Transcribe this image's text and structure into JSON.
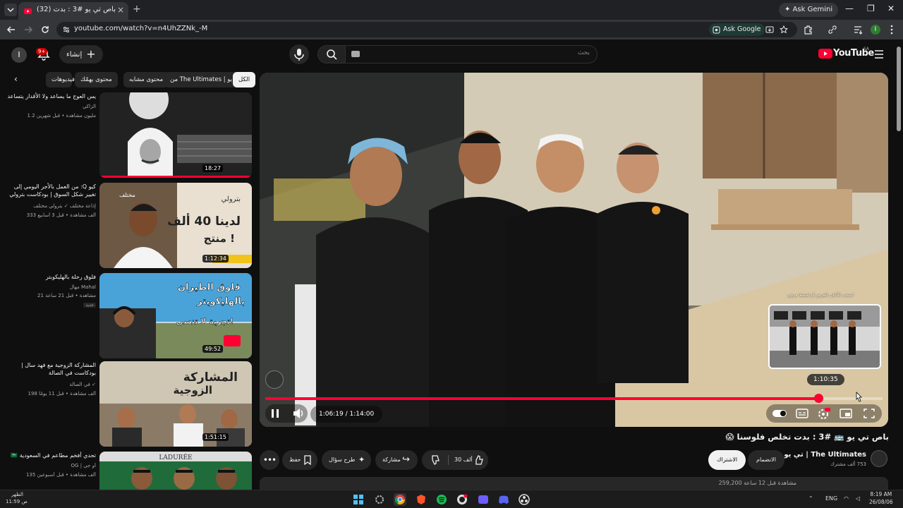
{
  "browser": {
    "tab_title": "باص تي يو #3 : بدت (32)",
    "url": "youtube.com/watch?v=n4UhZZNk_-M",
    "ask_gemini": "Ask Gemini",
    "ask_google": "Ask Google",
    "profile_initial": "I"
  },
  "masthead": {
    "avatar_initial": "I",
    "notif_count": "9+",
    "create_label": "إنشاء",
    "search_placeholder": "بحث",
    "logo_text": "YouTube",
    "region": "SA"
  },
  "chips": [
    {
      "label": "الكل",
      "active": true
    },
    {
      "label": "من The Ultimates | تي يو",
      "active": false
    },
    {
      "label": "محتوى مشابه",
      "active": false
    },
    {
      "label": "محتوى يهمّك",
      "active": false
    },
    {
      "label": "فيديوهات",
      "active": false
    }
  ],
  "recommendations": [
    {
      "title": "يس العوج ما يساعد ولا الأقدار يتساعد",
      "channel": "الزاكي",
      "meta": "1.2 مليون مشاهدة • قبل شهرين",
      "badge": "",
      "duration": "18:27",
      "progress": 1.0
    },
    {
      "title": "كيو Q: من العمل بالأجر اليومي إلى تغيير شكل السوق | بودكاست بترولي",
      "channel": "إذاعة مختلف ✓ بترولي مختلف",
      "meta": "333 ألف مشاهدة • قبل 3 أسابيع",
      "badge": "",
      "duration": "1:12:34",
      "progress": 0
    },
    {
      "title": "فلوق رحلة بالهليكوبتر",
      "channel": "مهال Mahal",
      "meta": "21 مشاهدة • قبل 21 ساعة",
      "badge": "جديد",
      "duration": "49:52",
      "progress": 0
    },
    {
      "title": "المشاركة الزوجية مع فهد سال | بودكاست في الصالة",
      "channel": "في الصالة ✓",
      "meta": "198 ألف مشاهدة • قبل 11 يومًا",
      "badge": "",
      "duration": "1:51:15",
      "progress": 0
    },
    {
      "title": "تحدي أفخم مطاعم في السعودية 🇸🇦",
      "channel": "OG | أو جي",
      "meta": "135 ألف مشاهدة • قبل أسبوعين",
      "badge": "",
      "duration": "",
      "progress": 0
    }
  ],
  "player": {
    "current_time": "1:06:19",
    "separator": "/",
    "total_time": "1:14:00",
    "played_fraction": 0.896,
    "hover_time": "1:10:35",
    "preview_label": "اسحب للأعلى للعرض أو اضغط مرتين"
  },
  "video": {
    "title": "باص تي يو 🚌 #3 : بدت تخلص فلوسنا 😱",
    "channel": "The Ultimates | تي يو",
    "subscribers": "753 ألف مشترك",
    "join_label": "الانضمام",
    "subscribe_label": "الاشتراك",
    "likes": "30 ألف",
    "share_label": "مشاركة",
    "ask_label": "طرح سؤال",
    "save_label": "حفظ",
    "description_peek": "259,200 مشاهدة قبل 12 ساعة"
  },
  "taskbar": {
    "weather_label": "الظهر",
    "weather_time": "11:59 ص",
    "lang": "ENG",
    "time": "8:19 AM",
    "date": "26/08/06"
  },
  "colors": {
    "accent_red": "#ff0033",
    "background": "#0f0f0f",
    "chip_bg": "#272727"
  }
}
